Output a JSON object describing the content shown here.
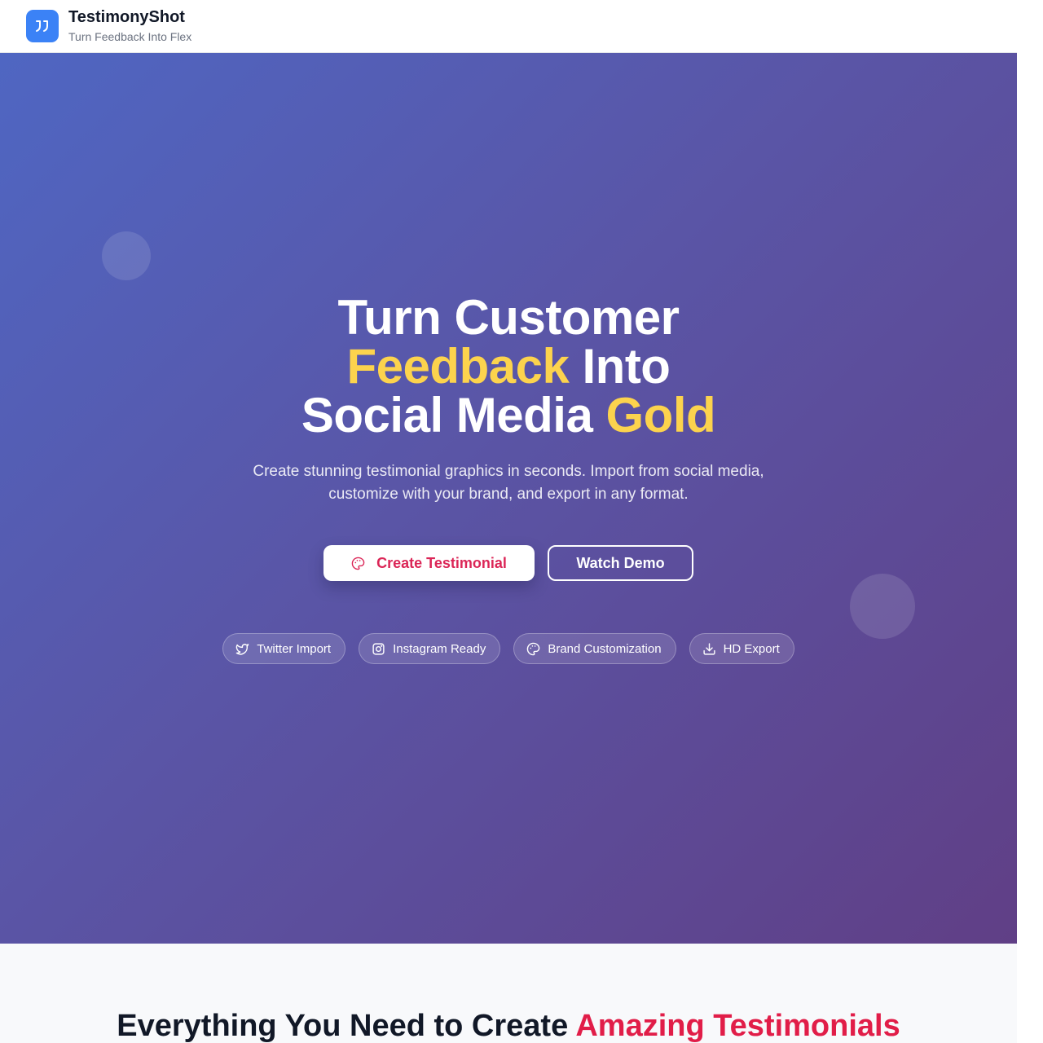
{
  "header": {
    "brand_name": "TestimonyShot",
    "tagline": "Turn Feedback Into Flex",
    "logo_icon": "quote-icon"
  },
  "hero": {
    "title_line1": "Turn Customer",
    "title_line2_highlight": "Feedback",
    "title_line2_rest": "Into",
    "title_line3_rest": "Social Media",
    "title_line3_highlight": "Gold",
    "subtitle": "Create stunning testimonial graphics in seconds. Import from social media, customize with your brand, and export in any format.",
    "primary_button": "Create Testimonial",
    "secondary_button": "Watch Demo",
    "features": [
      {
        "label": "Twitter Import",
        "icon": "twitter-icon"
      },
      {
        "label": "Instagram Ready",
        "icon": "instagram-icon"
      },
      {
        "label": "Brand Customization",
        "icon": "palette-icon"
      },
      {
        "label": "HD Export",
        "icon": "download-icon"
      }
    ]
  },
  "features_section": {
    "title_start": "Everything You Need to Create",
    "title_accent": "Amazing Testimonials"
  },
  "colors": {
    "primary_blue": "#3b82f6",
    "highlight_yellow": "#fcd34d",
    "accent_pink": "#e11d48",
    "hero_gradient_start": "#4f66c2",
    "hero_gradient_end": "#603f86"
  }
}
